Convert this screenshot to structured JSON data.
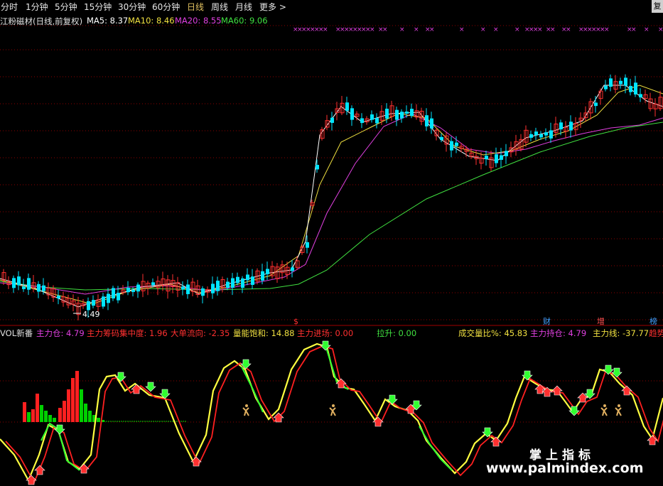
{
  "toolbar": {
    "tabs": [
      "分时",
      "1分钟",
      "5分钟",
      "15分钟",
      "30分钟",
      "60分钟",
      "日线",
      "周线",
      "月线",
      "更多 >"
    ],
    "active": "日线",
    "corner_label": "复"
  },
  "main_header": {
    "title": "江粉磁材(日线,前复权)",
    "items": [
      {
        "label": "MA5: 8.37",
        "color": "#ffffff"
      },
      {
        "label": "MA10: 8.46",
        "color": "#f0e040"
      },
      {
        "label": "MA20: 8.55",
        "color": "#e040e0"
      },
      {
        "label": "MA60: 9.06",
        "color": "#40e040"
      }
    ]
  },
  "price_annotations": {
    "low_label": "4.49",
    "bottom_markers": [
      {
        "text": "$",
        "color": "#ff3030"
      },
      {
        "text": "财",
        "color": "#40a0ff"
      },
      {
        "text": "增",
        "color": "#ff5050"
      },
      {
        "text": "榜",
        "color": "#40a0ff"
      }
    ],
    "top_x_marker": "×",
    "top_x_color": "#e040e0"
  },
  "indicator_header": {
    "items": [
      {
        "label": "VOL新番",
        "color": "#e0e0e0"
      },
      {
        "label": "主力仓: 4.79",
        "color": "#e040e0"
      },
      {
        "label": "主力筹码集中度: 1.96",
        "color": "#ff3030"
      },
      {
        "label": "大单流向: -2.35",
        "color": "#ff3030"
      },
      {
        "label": "量能饱和: 14.88",
        "color": "#f0e040"
      },
      {
        "label": "主力进场: 0.00",
        "color": "#ff3030"
      },
      {
        "label": "拉升: 0.00",
        "color": "#40e040"
      },
      {
        "label": "成交量比%: 45.83",
        "color": "#f0e040"
      },
      {
        "label": "主力持仓: 4.79",
        "color": "#e040e0"
      },
      {
        "label": "主力线: -37.77",
        "color": "#f0e040"
      },
      {
        "label": "趋势",
        "color": "#ff3030"
      }
    ]
  },
  "watermark": {
    "cn": "掌上指标",
    "url": "www.palmindex.com"
  },
  "colors": {
    "up": "#ff3030",
    "down": "#00e5ff",
    "ma5": "#ffffff",
    "ma10": "#f0e040",
    "ma20": "#e040e0",
    "ma60": "#40e040",
    "grid": "#8b0000"
  }
}
